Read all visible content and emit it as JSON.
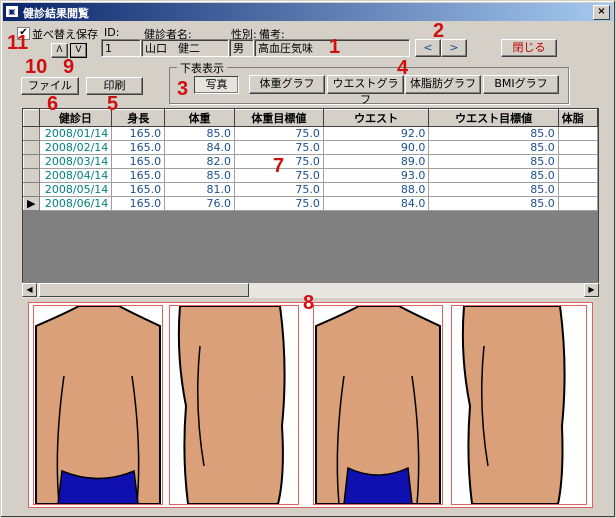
{
  "window": {
    "title": "健診結果閲覧",
    "close_glyph": "×"
  },
  "sort_save": {
    "label": "並べ替え保存",
    "checked": true
  },
  "sort_buttons": {
    "asc": "Λ",
    "desc": "V"
  },
  "patient": {
    "id_label": "ID:",
    "name_label": "健診者名:",
    "sex_label": "性別:",
    "note_label": "備考:",
    "id_value": "1",
    "name_value": "山口　健二",
    "sex_value": "男",
    "note_value": "高血圧気味"
  },
  "nav": {
    "prev": "<",
    "next": ">"
  },
  "close_button": "閉じる",
  "file_button": "ファイル",
  "print_button": "印刷",
  "lower_display": {
    "group_label": "下表表示",
    "photo_button": "写真",
    "weight_graph": "体重グラフ",
    "waist_graph": "ウエストグラフ",
    "bodyfat_graph": "体脂肪グラフ",
    "bmi_graph": "BMIグラフ"
  },
  "table": {
    "columns": [
      "健診日",
      "身長",
      "体重",
      "体重目標値",
      "ウエスト",
      "ウエスト目標値",
      "体脂"
    ],
    "rows": [
      [
        "2008/01/14",
        "165.0",
        "85.0",
        "75.0",
        "92.0",
        "85.0",
        ""
      ],
      [
        "2008/02/14",
        "165.0",
        "84.0",
        "75.0",
        "90.0",
        "85.0",
        ""
      ],
      [
        "2008/03/14",
        "165.0",
        "82.0",
        "75.0",
        "89.0",
        "85.0",
        ""
      ],
      [
        "2008/04/14",
        "165.0",
        "85.0",
        "75.0",
        "93.0",
        "85.0",
        ""
      ],
      [
        "2008/05/14",
        "165.0",
        "81.0",
        "75.0",
        "88.0",
        "85.0",
        ""
      ],
      [
        "2008/06/14",
        "165.0",
        "76.0",
        "75.0",
        "84.0",
        "85.0",
        ""
      ]
    ],
    "current_row_marker": "▶"
  },
  "annotations": [
    "1",
    "2",
    "3",
    "4",
    "5",
    "6",
    "7",
    "8",
    "9",
    "10",
    "11"
  ],
  "colors": {
    "accent_red": "#d01010",
    "date_text": "#008080",
    "value_text": "#1a4f8f",
    "skin": "#d9a07a",
    "shorts": "#1010b0"
  }
}
